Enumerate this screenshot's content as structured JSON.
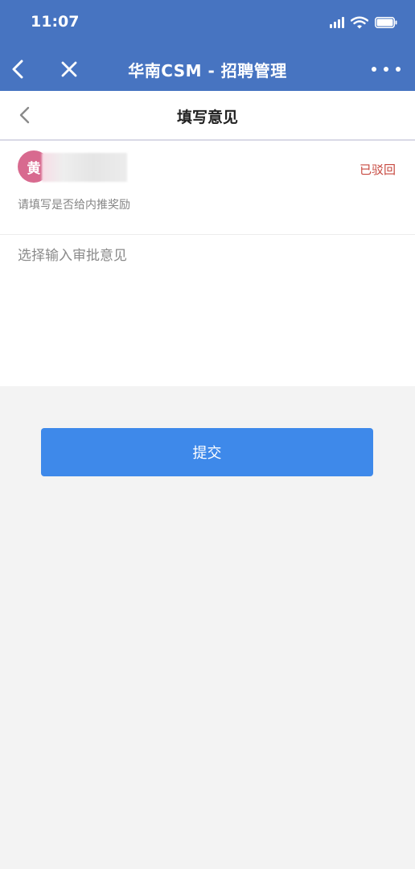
{
  "status_bar": {
    "time": "11:07"
  },
  "nav": {
    "title": "华南CSM - 招聘管理"
  },
  "subheader": {
    "title": "填写意见"
  },
  "applicant": {
    "avatar_initial": "黄",
    "status": "已驳回",
    "status_color": "#c7483f",
    "hint": "请填写是否给内推奖励"
  },
  "form": {
    "opinion_placeholder": "选择输入审批意见",
    "opinion_value": ""
  },
  "submit": {
    "label": "提交",
    "color": "#3e89ea"
  },
  "theme": {
    "header_color": "#4774c1",
    "avatar_color": "#d86a8f"
  }
}
